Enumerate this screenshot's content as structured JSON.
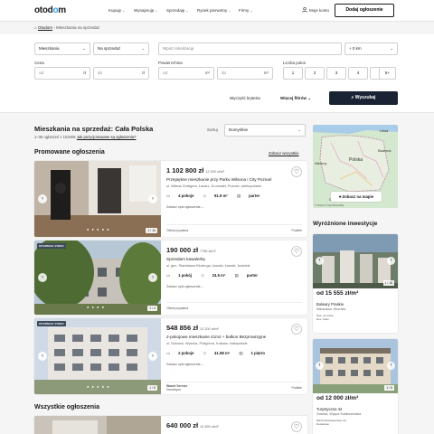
{
  "header": {
    "logo_prefix": "otod",
    "logo_o": "o",
    "logo_suffix": "m",
    "nav": [
      "Kupuję",
      "Wynajmuję",
      "Sprzedaję",
      "Rynek pierwotny",
      "Firmy"
    ],
    "my_account": "Moje konto",
    "add_listing": "Dodaj ogłoszenie"
  },
  "breadcrumb": {
    "home": "Otodom",
    "current": "Mieszkania na sprzedaż"
  },
  "filters": {
    "property_type": "Mieszkania",
    "transaction": "Na sprzedaż",
    "location_placeholder": "Wpisz lokalizację",
    "radius": "+ 0 km",
    "price_label": "Cena",
    "price_from_ph": "od",
    "price_to_ph": "do",
    "price_unit": "zł",
    "area_label": "Powierzchnia",
    "area_from_ph": "od",
    "area_to_ph": "do",
    "area_unit": "m²",
    "rooms_label": "Liczba pokoi",
    "rooms": [
      "1",
      "2",
      "3",
      "4",
      "5",
      "6+"
    ],
    "clear": "Wyczyść kryteria",
    "more": "Więcej filtrów",
    "search": "Wyszukaj"
  },
  "results": {
    "title": "Mieszkania na sprzedaż: Cała Polska",
    "count_text": "1–36 ogłoszeń z 103408",
    "saved_search_link": "Jak pozycjonowane są ogłoszenia?",
    "sort_label": "Sortuj",
    "sort_value": "Domyślnie",
    "promoted_title": "Promowane ogłoszenia",
    "see_all": "Zobacz wszystkie",
    "all_title": "Wszystkie ogłoszenia"
  },
  "listings": [
    {
      "price": "1 102 800 zł",
      "ppm": "12 000 zł/m²",
      "title": "Przepiękne mieszkanie przy Parku Wilsona i City Poznań",
      "address": "ul. Wiłana Grottgera, Łazarz, Grunwald, Poznań, wielkopolskie",
      "rooms": "4 pokoje",
      "area": "91.9 m²",
      "floor": "parter",
      "desc": "Zobacz opis ogłoszenia",
      "agency": "Oferta prywatna",
      "agency_type": "Podbite",
      "counter": "1 / 16",
      "badge": ""
    },
    {
      "price": "190 000 zł",
      "ppm": "7756 zł/m²",
      "title": "Sprzedam kawalerkę",
      "address": "ul. gen. Stanisława Kitułenga, kowalo, kowale, kodziele",
      "rooms": "1 pokój",
      "area": "24.5 m²",
      "floor": "parter",
      "desc": "Zobacz opis ogłoszenia",
      "agency": "Oferta prywatna",
      "agency_type": "",
      "counter": "1 / 4",
      "badge": "OFERMAS VIDEO"
    },
    {
      "price": "548 856 zł",
      "ppm": "12 200 zł/m²",
      "title": "2-pokojowe mieszkanie 41m2 + balkon Bezprowizyjne",
      "address": "ul. Sanowa, Wysoka, Podgórna, Kraków, małopolskie",
      "rooms": "2 pokoje",
      "area": "41.58 m²",
      "floor": "1 piętro",
      "desc": "Zobacz opis ogłoszenia",
      "agency": "Wawel Service",
      "agency_sub": "Deweloper",
      "agency_type": "Podbite",
      "counter": "1 / 8",
      "badge": "OFERMAS VIDEO"
    },
    {
      "price": "640 000 zł",
      "ppm": "10 455 zł/m²",
      "title": "",
      "address": "",
      "rooms": "",
      "area": "",
      "floor": "",
      "desc": "",
      "agency": "",
      "agency_type": "",
      "counter": "",
      "badge": ""
    }
  ],
  "map": {
    "button": "Zobacz na mapie",
    "labels": [
      "Litwa",
      "Polska",
      "Niemcy",
      "Czechy",
      "Słowacja",
      "Białoruś"
    ],
    "attribution": "© Otodom © OpenStreetMap"
  },
  "featured": {
    "title": "Wyróżnione inwestycje",
    "items": [
      {
        "price": "od 15 555 zł/m²",
        "name": "Bulwary Praskie",
        "location": "Warszawa, Wrocław",
        "dev": "Nas. na rzeka",
        "dev2": "Dev. Team",
        "counter": "1 / 18"
      },
      {
        "price": "od 12 000 zł/m²",
        "name": "Turystyczna 44",
        "location": "Gdańsk, Wyspa Sobieszewska",
        "dev": "DEVA Deweloperbep.net",
        "dev2": "Deweloper",
        "counter": "1 / 8"
      }
    ]
  },
  "colors": {
    "accent": "#2f9cf0",
    "search_button": "#1a2333",
    "background": "#f5f5f5"
  }
}
